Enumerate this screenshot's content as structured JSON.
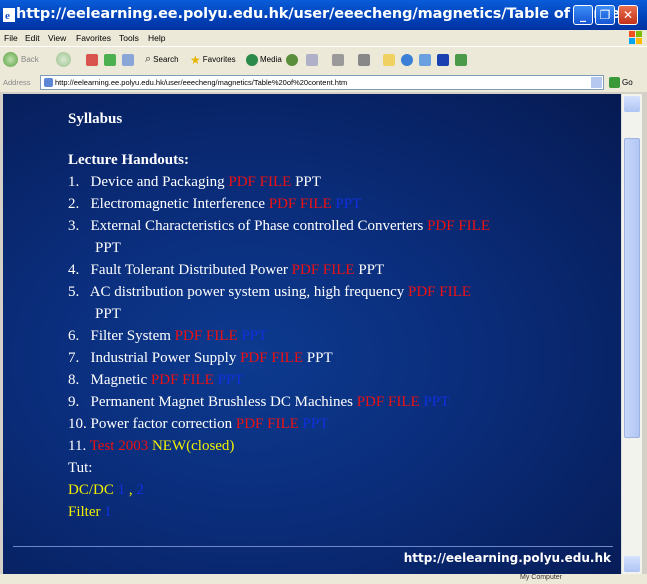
{
  "window": {
    "title": "http://eelearning.ee.polyu.edu.hk/user/eeecheng/magnetics/Table of conte...",
    "controls": {
      "minimize": "_",
      "maximize": "❐",
      "close": "✕"
    }
  },
  "menu": [
    "File",
    "Edit",
    "View",
    "Favorites",
    "Tools",
    "Help"
  ],
  "toolbar": {
    "back": "Back",
    "search": "Search",
    "favorites": "Favorites",
    "media": "Media"
  },
  "address": {
    "label": "Address",
    "url": "http://eelearning.ee.polyu.edu.hk/user/eeecheng/magnetics/Table%20of%20content.htm",
    "go": "Go"
  },
  "content": {
    "syllabus": "Syllabus",
    "handouts_heading": "Lecture Handouts:",
    "items": [
      {
        "num": "1.",
        "title": "Device and Packaging",
        "pdf": "PDF FILE",
        "ppt": "PPT"
      },
      {
        "num": "2.",
        "title": "Electromagnetic Interference",
        "pdf": "PDF FILE",
        "ppt": "PPT"
      },
      {
        "num": "3.",
        "title": "External Characteristics of Phase controlled Converters",
        "pdf": "PDF FILE",
        "ppt": "PPT"
      },
      {
        "num": "4.",
        "title": "Fault Tolerant Distributed Power",
        "pdf": "PDF FILE",
        "ppt": "PPT"
      },
      {
        "num": "5.",
        "title": "AC distribution power system using, high frequency",
        "pdf": "PDF FILE",
        "ppt": "PPT"
      },
      {
        "num": "6.",
        "title": "Filter System",
        "pdf": "PDF FILE",
        "ppt": "PPT"
      },
      {
        "num": "7.",
        "title": "Industrial Power Supply",
        "pdf": "PDF FILE",
        "ppt": "PPT"
      },
      {
        "num": "8.",
        "title": "Magnetic",
        "pdf": "PDF FILE",
        "ppt": "PPT"
      },
      {
        "num": "9.",
        "title": "Permanent Magnet Brushless DC Machines",
        "pdf": "PDF FILE",
        "ppt": "PPT"
      },
      {
        "num": "10.",
        "title": "Power factor correction",
        "pdf": "PDF FILE",
        "ppt": "PPT"
      }
    ],
    "item11": {
      "num": "11.",
      "test": "Test 2003",
      "note": "NEW(closed)"
    },
    "tut_label": "Tut:",
    "tut_dcdc": "DC/DC",
    "tut_link1": "1",
    "tut_sep": ",",
    "tut_link2": "2",
    "tut_filter": "Filter",
    "tut_filter_link": "1",
    "footer_url": "http://eelearning.polyu.edu.hk"
  },
  "status": {
    "zone": "My Computer"
  },
  "colors": {
    "pdf_link": "#ee1111",
    "ppt_link": "#1030e0",
    "tut_text": "#f4f000",
    "page_bg": "#0a2c79"
  }
}
